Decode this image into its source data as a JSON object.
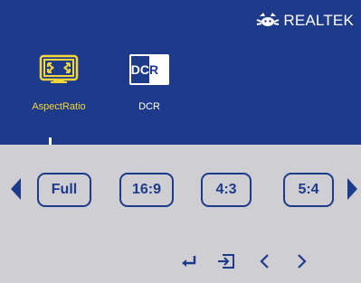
{
  "brand": {
    "name": "REALTEK",
    "icon": "realtek-crab-icon"
  },
  "menu": {
    "items": [
      {
        "label": "AspectRatio",
        "icon": "aspect-ratio-icon",
        "selected": true,
        "color": "#f4d63b"
      },
      {
        "label": "DCR",
        "icon": "dcr-icon",
        "selected": false,
        "icon_text_left": "DC",
        "icon_text_right": "R"
      }
    ]
  },
  "aspect_options": {
    "items": [
      {
        "label": "Full"
      },
      {
        "label": "16:9"
      },
      {
        "label": "4:3"
      },
      {
        "label": "5:4"
      }
    ],
    "prev_icon": "triangle-left-icon",
    "next_icon": "triangle-right-icon"
  },
  "keys": {
    "enter_icon": "enter-icon",
    "exit_icon": "exit-icon",
    "left_icon": "chevron-left-icon",
    "right_icon": "chevron-right-icon"
  },
  "colors": {
    "panel_blue": "#1e3a8a",
    "panel_gray": "#cfcfd3",
    "highlight_yellow": "#f4d63b"
  }
}
